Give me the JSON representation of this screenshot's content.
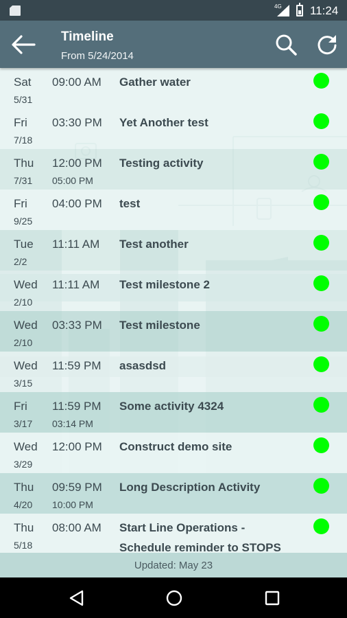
{
  "status_bar": {
    "network": "4G",
    "time": "11:24"
  },
  "app_bar": {
    "title": "Timeline",
    "subtitle": "From 5/24/2014",
    "icons": [
      "back-arrow-icon",
      "search-icon",
      "refresh-icon"
    ]
  },
  "colors": {
    "app_bar": "#546e7a",
    "status_bar": "#37474f",
    "status_dot": "#00ff00",
    "row_light": "#e9f4f3",
    "row_dark": "#c2dedb"
  },
  "activities": [
    {
      "day": "Sat",
      "date": "5/31",
      "start_time": "09:00 AM",
      "end_time": "",
      "description": "Gather water",
      "description_line2": ""
    },
    {
      "day": "Fri",
      "date": "7/18",
      "start_time": "03:30 PM",
      "end_time": "",
      "description": "Yet Another test",
      "description_line2": ""
    },
    {
      "day": "Thu",
      "date": "7/31",
      "start_time": "12:00 PM",
      "end_time": "05:00 PM",
      "description": "Testing activity",
      "description_line2": ""
    },
    {
      "day": "Fri",
      "date": "9/25",
      "start_time": "04:00 PM",
      "end_time": "",
      "description": "test",
      "description_line2": ""
    },
    {
      "day": "Tue",
      "date": "2/2",
      "start_time": "11:11 AM",
      "end_time": "",
      "description": "Test another",
      "description_line2": ""
    },
    {
      "day": "Wed",
      "date": "2/10",
      "start_time": "11:11 AM",
      "end_time": "",
      "description": "Test milestone 2",
      "description_line2": ""
    },
    {
      "day": "Wed",
      "date": "2/10",
      "start_time": "03:33 PM",
      "end_time": "",
      "description": "Test milestone",
      "description_line2": ""
    },
    {
      "day": "Wed",
      "date": "3/15",
      "start_time": "11:59 PM",
      "end_time": "",
      "description": "asasdsd",
      "description_line2": ""
    },
    {
      "day": "Fri",
      "date": "3/17",
      "start_time": "11:59 PM",
      "end_time": "03:14 PM",
      "description": "Some activity 4324",
      "description_line2": ""
    },
    {
      "day": "Wed",
      "date": "3/29",
      "start_time": "12:00 PM",
      "end_time": "",
      "description": "Construct demo site",
      "description_line2": ""
    },
    {
      "day": "Thu",
      "date": "4/20",
      "start_time": "09:59 PM",
      "end_time": "10:00 PM",
      "description": "Long Description Activity",
      "description_line2": ""
    },
    {
      "day": "Thu",
      "date": "5/18",
      "start_time": "08:00 AM",
      "end_time": "",
      "description": "Start Line Operations -",
      "description_line2": "Schedule reminder to STOPS"
    }
  ],
  "footer": {
    "updated_text": "Updated: May 23"
  },
  "nav_bar": {
    "icons": [
      "back-triangle-icon",
      "home-circle-icon",
      "recents-square-icon"
    ]
  }
}
